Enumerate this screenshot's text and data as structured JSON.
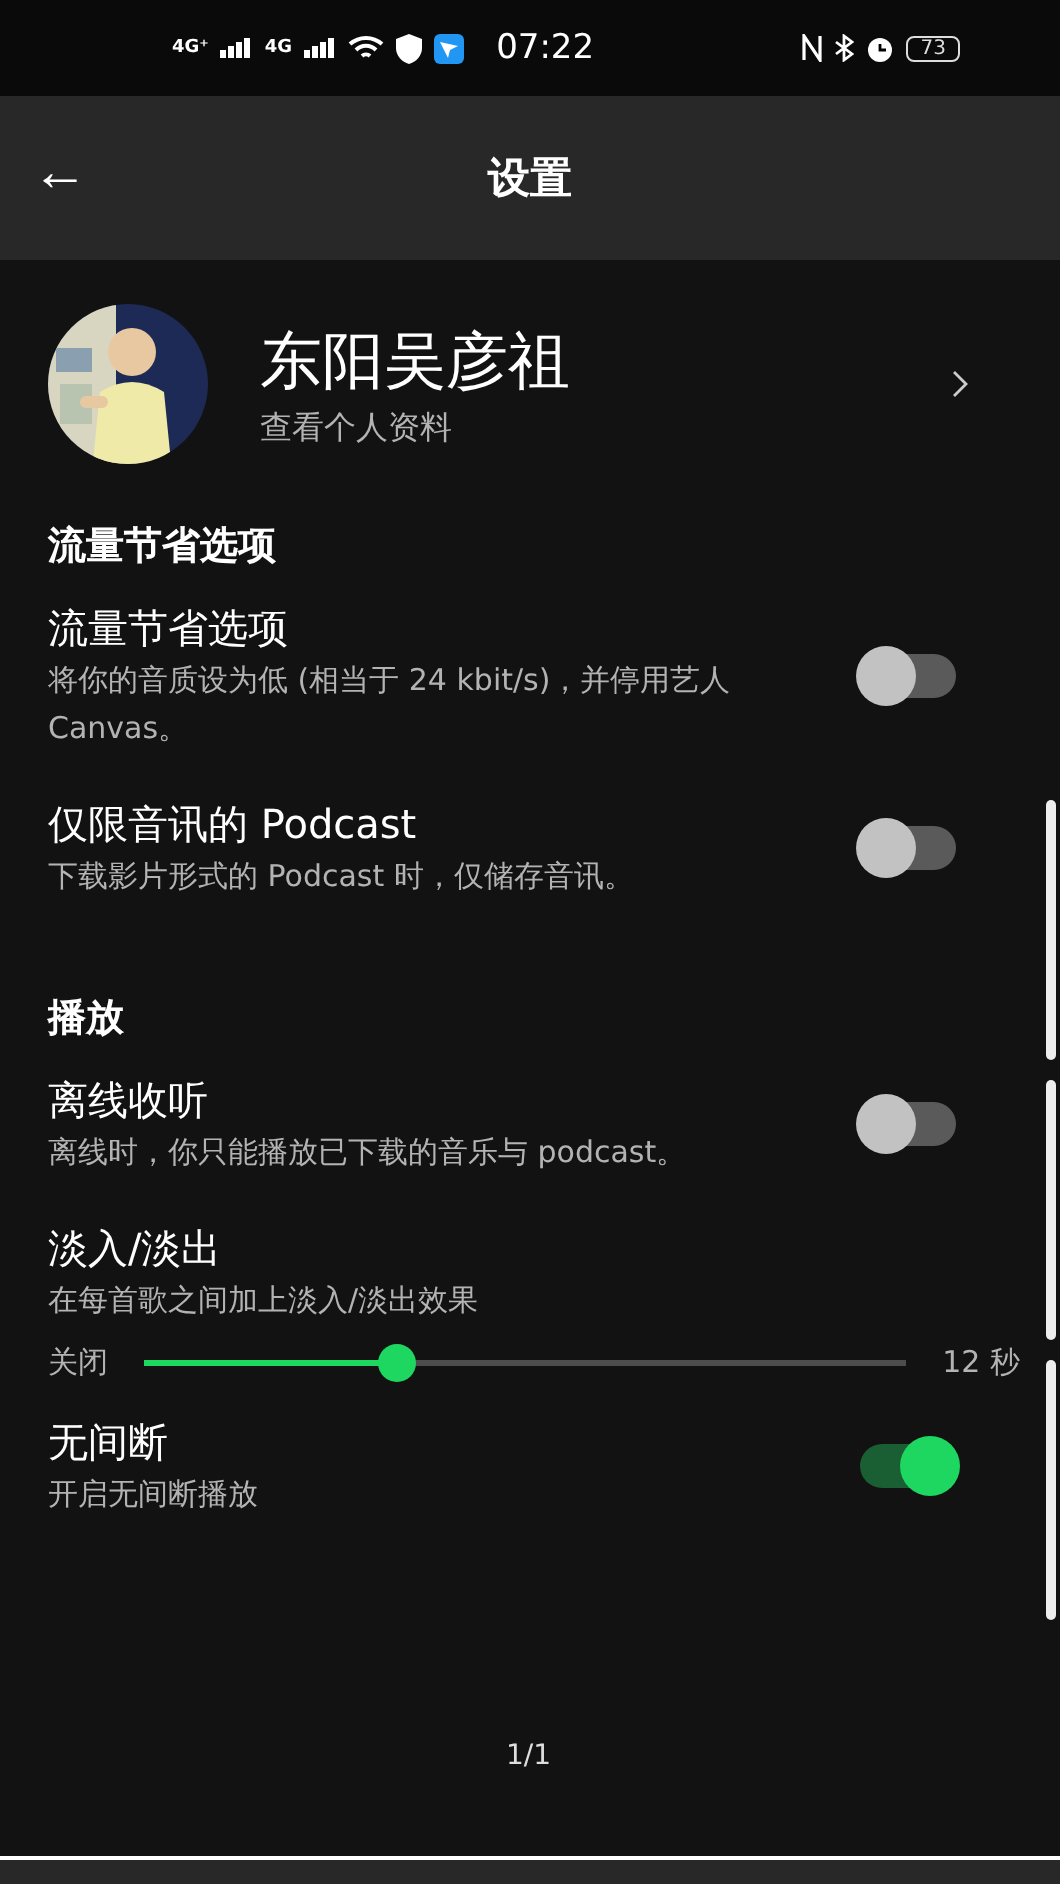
{
  "status_bar": {
    "signal_1": "4G⁺",
    "signal_2": "4G",
    "time": "07:22",
    "battery": "73"
  },
  "header": {
    "back": "←",
    "title": "设置"
  },
  "profile": {
    "name": "东阳吴彦祖",
    "subtitle": "查看个人资料"
  },
  "sections": [
    {
      "title": "流量节省选项",
      "items": [
        {
          "kind": "toggle",
          "title": "流量节省选项",
          "description": "将你的音质设为低 (相当于 24 kbit/s)，并停用艺人 Canvas。",
          "on": false
        },
        {
          "kind": "toggle",
          "title": "仅限音讯的 Podcast",
          "description": "下载影片形式的 Podcast 时，仅储存音讯。",
          "on": false
        }
      ]
    },
    {
      "title": "播放",
      "items": [
        {
          "kind": "toggle",
          "title": "离线收听",
          "description": "离线时，你只能播放已下载的音乐与 podcast。",
          "on": false
        },
        {
          "kind": "slider",
          "title": "淡入/淡出",
          "description": "在每首歌之间加上淡入/淡出效果",
          "min_label": "关闭",
          "max_label": "12 秒",
          "level": 0.33
        },
        {
          "kind": "toggle",
          "title": "无间断",
          "description": "开启无间断播放",
          "on": true
        }
      ]
    }
  ],
  "page_indicator": "1/1"
}
